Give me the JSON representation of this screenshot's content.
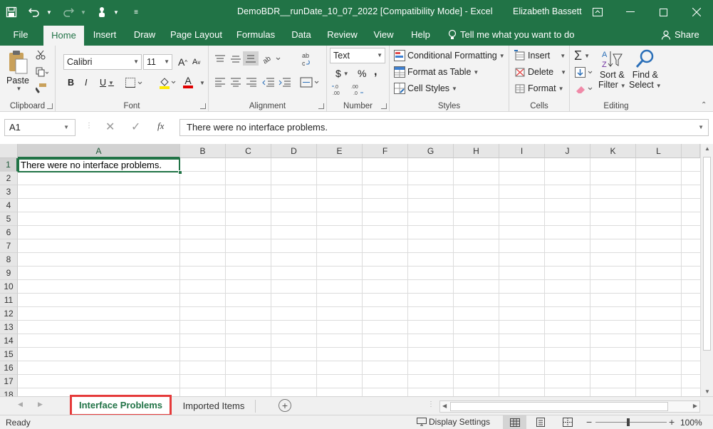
{
  "window": {
    "title": "DemoBDR__runDate_10_07_2022  [Compatibility Mode]  -  Excel",
    "user": "Elizabeth Bassett"
  },
  "ribbon_tabs": [
    "File",
    "Home",
    "Insert",
    "Draw",
    "Page Layout",
    "Formulas",
    "Data",
    "Review",
    "View",
    "Help"
  ],
  "active_tab": "Home",
  "tell_me": "Tell me what you want to do",
  "share": "Share",
  "ribbon": {
    "clipboard": {
      "label": "Clipboard",
      "paste": "Paste"
    },
    "font": {
      "label": "Font",
      "family": "Calibri",
      "size": "11",
      "bold": "B",
      "italic": "I",
      "underline": "U",
      "grow": "A",
      "shrink": "A",
      "font_color": "A"
    },
    "alignment": {
      "label": "Alignment"
    },
    "number": {
      "label": "Number",
      "format": "Text",
      "currency": "$",
      "percent": "%",
      "comma": ",",
      "inc_decimal": "←.0\n.00",
      "dec_decimal": ".00\n→.0"
    },
    "styles": {
      "label": "Styles",
      "conditional": "Conditional Formatting",
      "format_table": "Format as Table",
      "cell_styles": "Cell Styles"
    },
    "cells": {
      "label": "Cells",
      "insert": "Insert",
      "delete": "Delete",
      "format": "Format"
    },
    "editing": {
      "label": "Editing",
      "sum": "Σ",
      "sort_line1": "Sort &",
      "sort_line2": "Filter",
      "find_line1": "Find &",
      "find_line2": "Select"
    }
  },
  "formula_bar": {
    "name_box": "A1",
    "fx": "fx",
    "value": "There were no interface problems."
  },
  "columns": [
    "A",
    "B",
    "C",
    "D",
    "E",
    "F",
    "G",
    "H",
    "I",
    "J",
    "K",
    "L"
  ],
  "rows": [
    "1",
    "2",
    "3",
    "4",
    "5",
    "6",
    "7",
    "8",
    "9",
    "10",
    "11",
    "12",
    "13",
    "14",
    "15",
    "16",
    "17",
    "18"
  ],
  "cells": {
    "A1": "There were no interface problems."
  },
  "sheets": [
    "Interface Problems",
    "Imported Items"
  ],
  "active_sheet": "Interface Problems",
  "status": {
    "ready": "Ready",
    "display_settings": "Display Settings",
    "zoom": "100%"
  },
  "colors": {
    "accent": "#217346",
    "highlight_box": "#e53a3a"
  }
}
